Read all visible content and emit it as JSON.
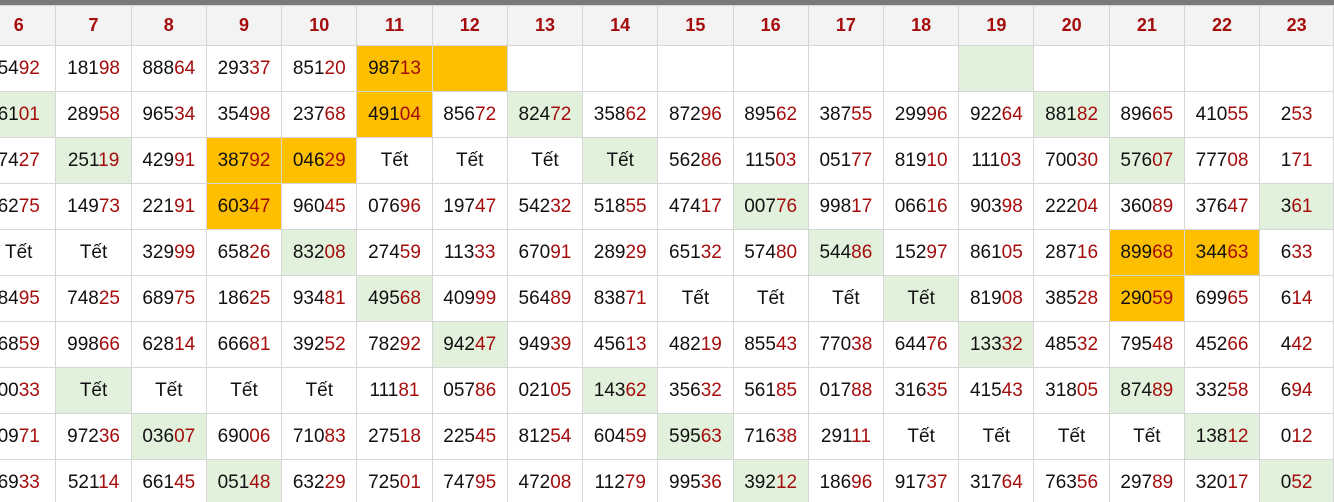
{
  "colors": {
    "header_text": "#a50d0d",
    "green": "#e2f1dc",
    "orange": "#fdbf00",
    "top_bar": "#7a7a7a"
  },
  "headers": [
    "6",
    "7",
    "8",
    "9",
    "10",
    "11",
    "12",
    "13",
    "14",
    "15",
    "16",
    "17",
    "18",
    "19",
    "20",
    "21",
    "22",
    "23"
  ],
  "rows": [
    [
      {
        "v": "5492"
      },
      {
        "v": "18198"
      },
      {
        "v": "88864"
      },
      {
        "v": "29337"
      },
      {
        "v": "85120"
      },
      {
        "v": "98713",
        "h": "o"
      },
      {
        "v": "",
        "h": "o"
      },
      {
        "v": ""
      },
      {
        "v": ""
      },
      {
        "v": ""
      },
      {
        "v": ""
      },
      {
        "v": ""
      },
      {
        "v": ""
      },
      {
        "v": "",
        "h": "g"
      },
      {
        "v": ""
      },
      {
        "v": ""
      },
      {
        "v": ""
      },
      {
        "v": ""
      }
    ],
    [
      {
        "v": "6101",
        "h": "g"
      },
      {
        "v": "28958"
      },
      {
        "v": "96534"
      },
      {
        "v": "35498"
      },
      {
        "v": "23768"
      },
      {
        "v": "49104",
        "h": "o"
      },
      {
        "v": "85672"
      },
      {
        "v": "82472",
        "h": "g"
      },
      {
        "v": "35862"
      },
      {
        "v": "87296"
      },
      {
        "v": "89562"
      },
      {
        "v": "38755"
      },
      {
        "v": "29996"
      },
      {
        "v": "92264"
      },
      {
        "v": "88182",
        "h": "g"
      },
      {
        "v": "89665"
      },
      {
        "v": "41055"
      },
      {
        "v": "253"
      }
    ],
    [
      {
        "v": "7427"
      },
      {
        "v": "25119",
        "h": "g"
      },
      {
        "v": "42991"
      },
      {
        "v": "38792",
        "h": "o"
      },
      {
        "v": "04629",
        "h": "o"
      },
      {
        "v": "Tết"
      },
      {
        "v": "Tết"
      },
      {
        "v": "Tết"
      },
      {
        "v": "Tết",
        "h": "g"
      },
      {
        "v": "56286"
      },
      {
        "v": "11503"
      },
      {
        "v": "05177"
      },
      {
        "v": "81910"
      },
      {
        "v": "11103"
      },
      {
        "v": "70030"
      },
      {
        "v": "57607",
        "h": "g"
      },
      {
        "v": "77708"
      },
      {
        "v": "171"
      }
    ],
    [
      {
        "v": "6275"
      },
      {
        "v": "14973"
      },
      {
        "v": "22191"
      },
      {
        "v": "60347",
        "h": "o"
      },
      {
        "v": "96045"
      },
      {
        "v": "07696"
      },
      {
        "v": "19747"
      },
      {
        "v": "54232"
      },
      {
        "v": "51855"
      },
      {
        "v": "47417"
      },
      {
        "v": "00776",
        "h": "g"
      },
      {
        "v": "99817"
      },
      {
        "v": "06616"
      },
      {
        "v": "90398"
      },
      {
        "v": "22204"
      },
      {
        "v": "36089"
      },
      {
        "v": "37647"
      },
      {
        "v": "361",
        "h": "g"
      }
    ],
    [
      {
        "v": "Tết"
      },
      {
        "v": "Tết"
      },
      {
        "v": "32999"
      },
      {
        "v": "65826"
      },
      {
        "v": "83208",
        "h": "g"
      },
      {
        "v": "27459"
      },
      {
        "v": "11333"
      },
      {
        "v": "67091"
      },
      {
        "v": "28929"
      },
      {
        "v": "65132"
      },
      {
        "v": "57480"
      },
      {
        "v": "54486",
        "h": "g"
      },
      {
        "v": "15297"
      },
      {
        "v": "86105"
      },
      {
        "v": "28716"
      },
      {
        "v": "89968",
        "h": "o"
      },
      {
        "v": "34463",
        "h": "o"
      },
      {
        "v": "633"
      }
    ],
    [
      {
        "v": "8495"
      },
      {
        "v": "74825"
      },
      {
        "v": "68975"
      },
      {
        "v": "18625"
      },
      {
        "v": "93481"
      },
      {
        "v": "49568",
        "h": "g"
      },
      {
        "v": "40999"
      },
      {
        "v": "56489"
      },
      {
        "v": "83871"
      },
      {
        "v": "Tết"
      },
      {
        "v": "Tết"
      },
      {
        "v": "Tết"
      },
      {
        "v": "Tết",
        "h": "g"
      },
      {
        "v": "81908"
      },
      {
        "v": "38528"
      },
      {
        "v": "29059",
        "h": "o"
      },
      {
        "v": "69965"
      },
      {
        "v": "614"
      }
    ],
    [
      {
        "v": "6859"
      },
      {
        "v": "99866"
      },
      {
        "v": "62814"
      },
      {
        "v": "66681"
      },
      {
        "v": "39252"
      },
      {
        "v": "78292"
      },
      {
        "v": "94247",
        "h": "g"
      },
      {
        "v": "94939"
      },
      {
        "v": "45613"
      },
      {
        "v": "48219"
      },
      {
        "v": "85543"
      },
      {
        "v": "77038"
      },
      {
        "v": "64476"
      },
      {
        "v": "13332",
        "h": "g"
      },
      {
        "v": "48532"
      },
      {
        "v": "79548"
      },
      {
        "v": "45266"
      },
      {
        "v": "442"
      }
    ],
    [
      {
        "v": "0033"
      },
      {
        "v": "Tết",
        "h": "g"
      },
      {
        "v": "Tết"
      },
      {
        "v": "Tết"
      },
      {
        "v": "Tết"
      },
      {
        "v": "11181"
      },
      {
        "v": "05786"
      },
      {
        "v": "02105"
      },
      {
        "v": "14362",
        "h": "g"
      },
      {
        "v": "35632"
      },
      {
        "v": "56185"
      },
      {
        "v": "01788"
      },
      {
        "v": "31635"
      },
      {
        "v": "41543"
      },
      {
        "v": "31805"
      },
      {
        "v": "87489",
        "h": "g"
      },
      {
        "v": "33258"
      },
      {
        "v": "694"
      }
    ],
    [
      {
        "v": "0971"
      },
      {
        "v": "97236"
      },
      {
        "v": "03607",
        "h": "g"
      },
      {
        "v": "69006"
      },
      {
        "v": "71083"
      },
      {
        "v": "27518"
      },
      {
        "v": "22545"
      },
      {
        "v": "81254"
      },
      {
        "v": "60459"
      },
      {
        "v": "59563",
        "h": "g"
      },
      {
        "v": "71638"
      },
      {
        "v": "29111"
      },
      {
        "v": "Tết"
      },
      {
        "v": "Tết"
      },
      {
        "v": "Tết"
      },
      {
        "v": "Tết"
      },
      {
        "v": "13812",
        "h": "g"
      },
      {
        "v": "012"
      }
    ],
    [
      {
        "v": "6933"
      },
      {
        "v": "52114"
      },
      {
        "v": "66145"
      },
      {
        "v": "05148",
        "h": "g"
      },
      {
        "v": "63229"
      },
      {
        "v": "72501"
      },
      {
        "v": "74795"
      },
      {
        "v": "47208"
      },
      {
        "v": "11279"
      },
      {
        "v": "99536"
      },
      {
        "v": "39212",
        "h": "g"
      },
      {
        "v": "18696"
      },
      {
        "v": "91737"
      },
      {
        "v": "31764"
      },
      {
        "v": "76356"
      },
      {
        "v": "29789"
      },
      {
        "v": "32017"
      },
      {
        "v": "052",
        "h": "g"
      }
    ]
  ]
}
